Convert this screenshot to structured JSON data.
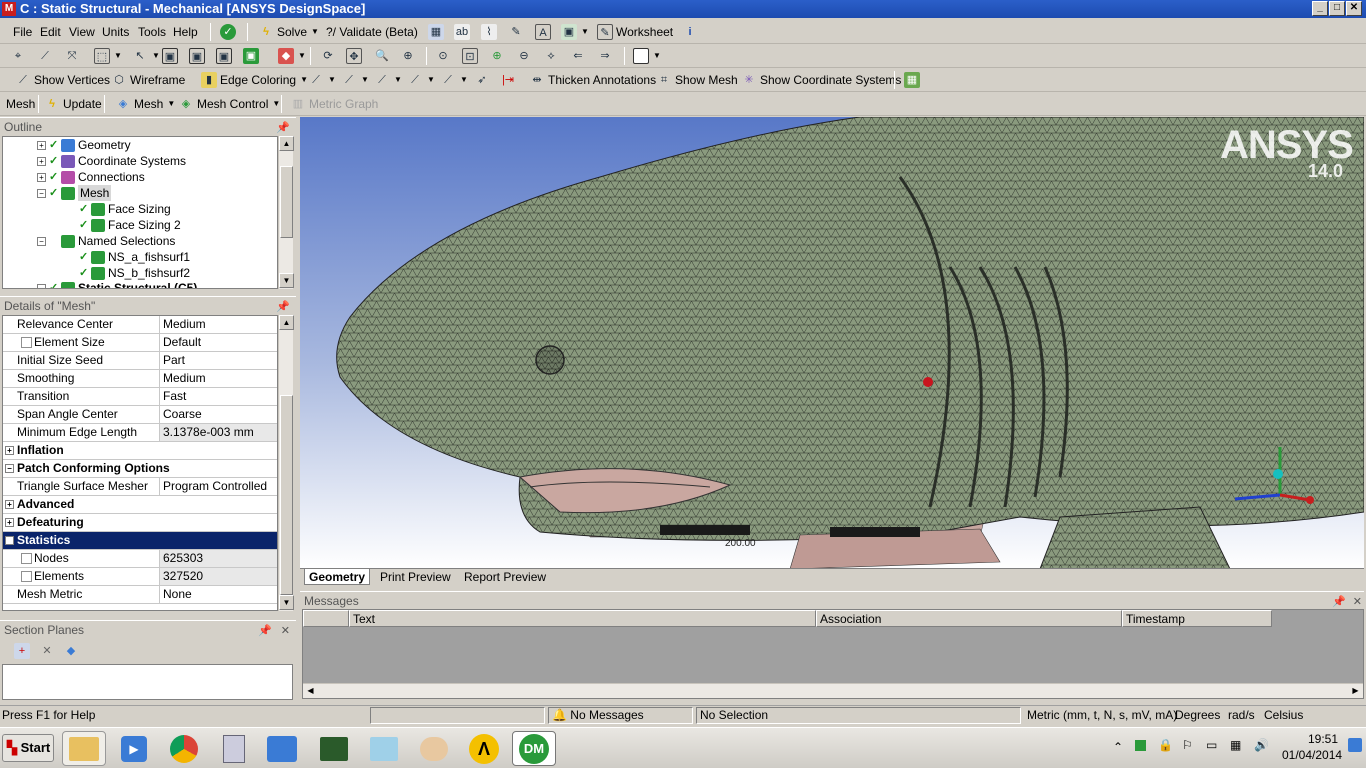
{
  "window": {
    "title": "C : Static Structural - Mechanical [ANSYS DesignSpace]",
    "app_icon": "M",
    "min": "_",
    "max": "□",
    "close": "✕"
  },
  "menu": [
    {
      "label": "File"
    },
    {
      "label": "Edit"
    },
    {
      "label": "View"
    },
    {
      "label": "Units"
    },
    {
      "label": "Tools"
    },
    {
      "label": "Help"
    }
  ],
  "toolbar1": {
    "solve": "Solve",
    "validate": "?/ Validate (Beta)",
    "worksheet": "Worksheet"
  },
  "toolbar3": {
    "show_vertices": "Show Vertices",
    "wireframe": "Wireframe",
    "edge_coloring": "Edge Coloring",
    "thicken": "Thicken Annotations",
    "show_mesh": "Show Mesh",
    "show_cs": "Show Coordinate Systems"
  },
  "context": {
    "mesh": "Mesh",
    "update": "Update",
    "mesh_dd": "Mesh",
    "mesh_control": "Mesh Control",
    "metric_graph": "Metric Graph"
  },
  "outline": {
    "title": "Outline",
    "items": [
      {
        "label": "Geometry",
        "color": "#3a7bd5"
      },
      {
        "label": "Coordinate Systems",
        "color": "#7a58b8"
      },
      {
        "label": "Connections",
        "color": "#b44da8"
      },
      {
        "label": "Mesh",
        "color": "#2a9a3a"
      },
      {
        "label": "Face Sizing",
        "color": "#2a9a3a"
      },
      {
        "label": "Face Sizing 2",
        "color": "#2a9a3a"
      },
      {
        "label": "Named Selections",
        "color": "#2a9a3a"
      },
      {
        "label": "NS_a_fishsurf1",
        "color": "#2a9a3a"
      },
      {
        "label": "NS_b_fishsurf2",
        "color": "#2a9a3a"
      },
      {
        "label": "Static Structural (C5)",
        "color": "#2a9a3a"
      }
    ]
  },
  "details": {
    "title": "Details of \"Mesh\"",
    "rows": [
      {
        "label": "Relevance Center",
        "value": "Medium"
      },
      {
        "label": "Element Size",
        "value": "Default"
      },
      {
        "label": "Initial Size Seed",
        "value": "Part"
      },
      {
        "label": "Smoothing",
        "value": "Medium"
      },
      {
        "label": "Transition",
        "value": "Fast"
      },
      {
        "label": "Span Angle Center",
        "value": "Coarse"
      },
      {
        "label": "Minimum Edge Length",
        "value": "3.1378e-003 mm"
      },
      {
        "label": "Inflation",
        "value": ""
      },
      {
        "label": "Patch Conforming Options",
        "value": ""
      },
      {
        "label": "Triangle Surface Mesher",
        "value": "Program Controlled"
      },
      {
        "label": "Advanced",
        "value": ""
      },
      {
        "label": "Defeaturing",
        "value": ""
      },
      {
        "label": "Statistics",
        "value": ""
      },
      {
        "label": "Nodes",
        "value": "625303"
      },
      {
        "label": "Elements",
        "value": "327520"
      },
      {
        "label": "Mesh Metric",
        "value": "None"
      }
    ]
  },
  "section_planes": {
    "title": "Section Planes"
  },
  "viewport": {
    "logo": "ANSYS",
    "version": "14.0",
    "scale_label": "200.00"
  },
  "view_tabs": [
    {
      "label": "Geometry"
    },
    {
      "label": "Print Preview"
    },
    {
      "label": "Report Preview"
    }
  ],
  "messages": {
    "title": "Messages",
    "columns": [
      "Text",
      "Association",
      "Timestamp"
    ]
  },
  "status": {
    "help": "Press F1 for Help",
    "messages": "No Messages",
    "selection": "No Selection",
    "units": "Metric (mm, t, N, s, mV, mA)",
    "angle": "Degrees",
    "rate": "rad/s",
    "temp": "Celsius"
  },
  "taskbar": {
    "start": "Start",
    "time": "19:51",
    "date": "01/04/2014",
    "dm": "DM"
  }
}
